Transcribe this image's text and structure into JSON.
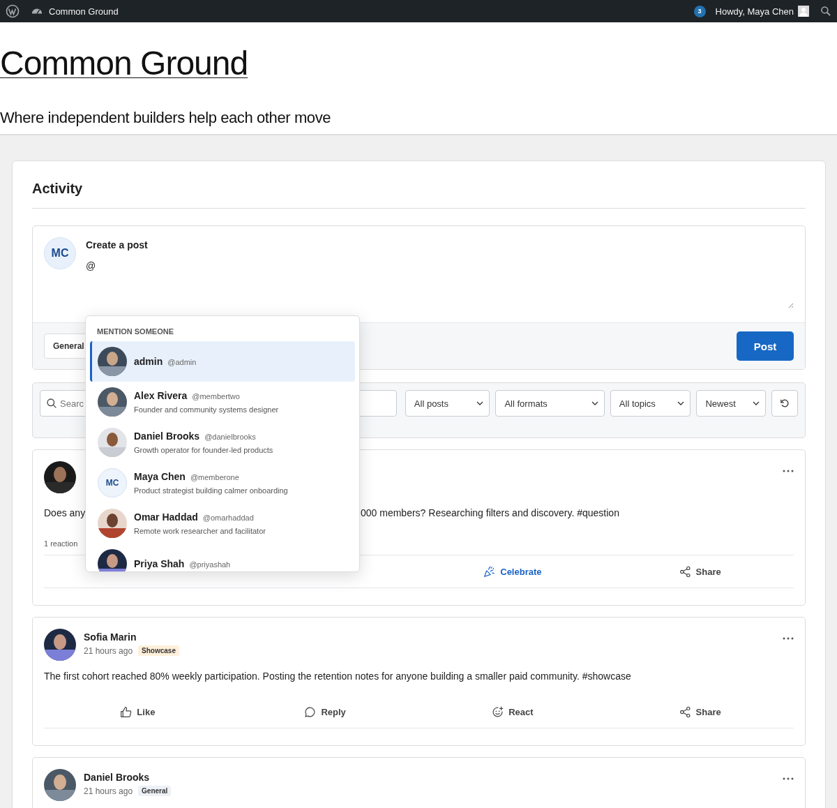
{
  "admin_bar": {
    "site_name": "Common Ground",
    "notifications": "3",
    "greeting": "Howdy, Maya Chen"
  },
  "site": {
    "title": "Common Ground",
    "tagline": "Where independent builders help each other move"
  },
  "activity": {
    "heading": "Activity",
    "composer": {
      "initials": "MC",
      "title": "Create a post",
      "value": "@",
      "topic": "General",
      "post_button": "Post"
    },
    "mention_menu": {
      "heading": "MENTION SOMEONE",
      "members": [
        {
          "name": "admin",
          "handle": "@admin",
          "selected": true
        },
        {
          "name": "Alex Rivera",
          "handle": "@membertwo",
          "bio": "Founder and community systems designer",
          "selected": false
        },
        {
          "name": "Daniel Brooks",
          "handle": "@danielbrooks",
          "bio": "Growth operator for founder-led products",
          "selected": false
        },
        {
          "kind": "initials",
          "initials": "MC",
          "name": "Maya Chen",
          "handle": "@memberone",
          "bio": "Product strategist building calmer onboarding",
          "selected": false
        },
        {
          "name": "Omar Haddad",
          "handle": "@omarhaddad",
          "bio": "Remote work researcher and facilitator",
          "selected": false
        },
        {
          "name": "Priya Shah",
          "handle": "@priyashah",
          "selected": false
        }
      ]
    },
    "filters": {
      "search_placeholder": "Searc",
      "selects": [
        "All posts",
        "All formats",
        "All topics",
        "Newest"
      ]
    },
    "posts": [
      {
        "text_start": "Does any",
        "text_end": "000 members? Researching filters and discovery. #question",
        "reactions": "1 reaction",
        "actions": [
          {
            "kind": "celebrate",
            "label": "Celebrate",
            "active": true
          },
          {
            "kind": "share",
            "label": "Share",
            "active": false
          }
        ]
      },
      {
        "author": "Sofia Marin",
        "time": "21 hours ago",
        "tag": {
          "label": "Showcase",
          "color": "#fff0db"
        },
        "text": "The first cohort reached 80% weekly participation. Posting the retention notes for anyone building a smaller paid community. #showcase",
        "actions": [
          {
            "kind": "like",
            "label": "Like",
            "active": false
          },
          {
            "kind": "reply",
            "label": "Reply",
            "active": false
          },
          {
            "kind": "react",
            "label": "React",
            "active": false
          },
          {
            "kind": "share",
            "label": "Share",
            "active": false
          }
        ]
      },
      {
        "author": "Daniel Brooks",
        "time": "21 hours ago",
        "tag": {
          "label": "General",
          "color": "#edf1f6"
        }
      }
    ]
  }
}
